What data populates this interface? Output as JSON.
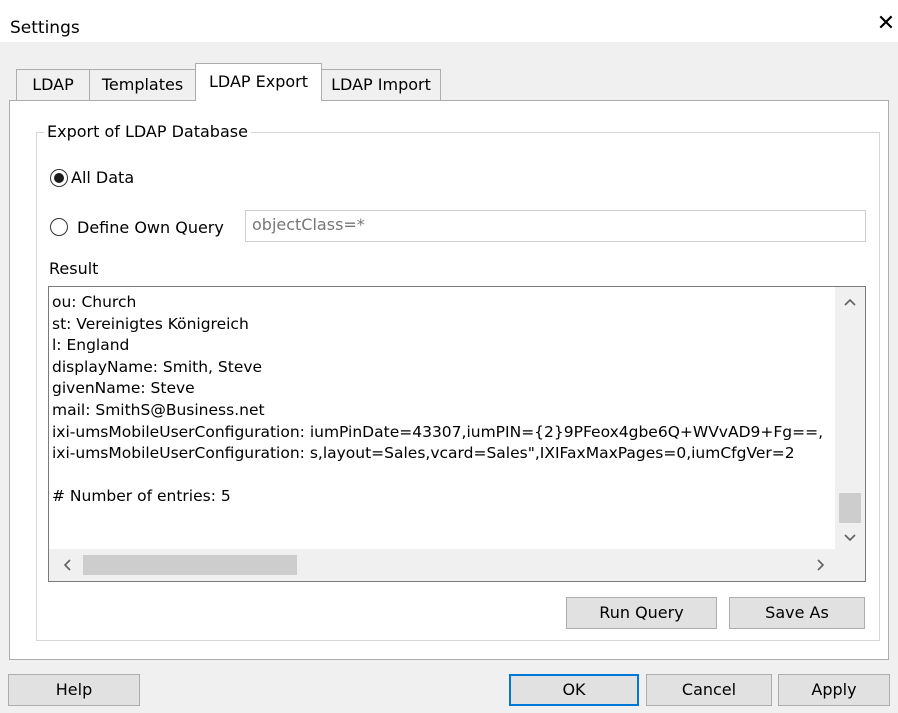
{
  "window": {
    "title": "Settings",
    "close_label": "✕"
  },
  "tabs": [
    {
      "label": "LDAP",
      "active": false
    },
    {
      "label": "Templates",
      "active": false
    },
    {
      "label": "LDAP Export",
      "active": true
    },
    {
      "label": "LDAP Import",
      "active": false
    }
  ],
  "export": {
    "group_label": "Export of LDAP Database",
    "option_all": "All Data",
    "option_all_selected": true,
    "option_query": "Define Own Query",
    "option_query_selected": false,
    "query_value": "objectClass=*"
  },
  "result": {
    "label": "Result",
    "lines": [
      "ou: Church",
      "st: Vereinigtes Königreich",
      "l: England",
      "displayName: Smith, Steve",
      "givenName: Steve",
      "mail: SmithS@Business.net",
      "ixi-umsMobileUserConfiguration: iumPinDate=43307,iumPIN={2}9PFeox4gbe6Q+WVvAD9+Fg==,",
      "ixi-umsMobileUserConfiguration: s,layout=Sales,vcard=Sales\",IXIFaxMaxPages=0,iumCfgVer=2",
      "",
      "# Number of entries: 5"
    ]
  },
  "buttons": {
    "run_query": "Run Query",
    "save_as": "Save As",
    "help": "Help",
    "ok": "OK",
    "cancel": "Cancel",
    "apply": "Apply"
  },
  "icons": {
    "up": "chevron-up-icon",
    "down": "chevron-down-icon",
    "left": "chevron-left-icon",
    "right": "chevron-right-icon",
    "close": "close-icon"
  }
}
